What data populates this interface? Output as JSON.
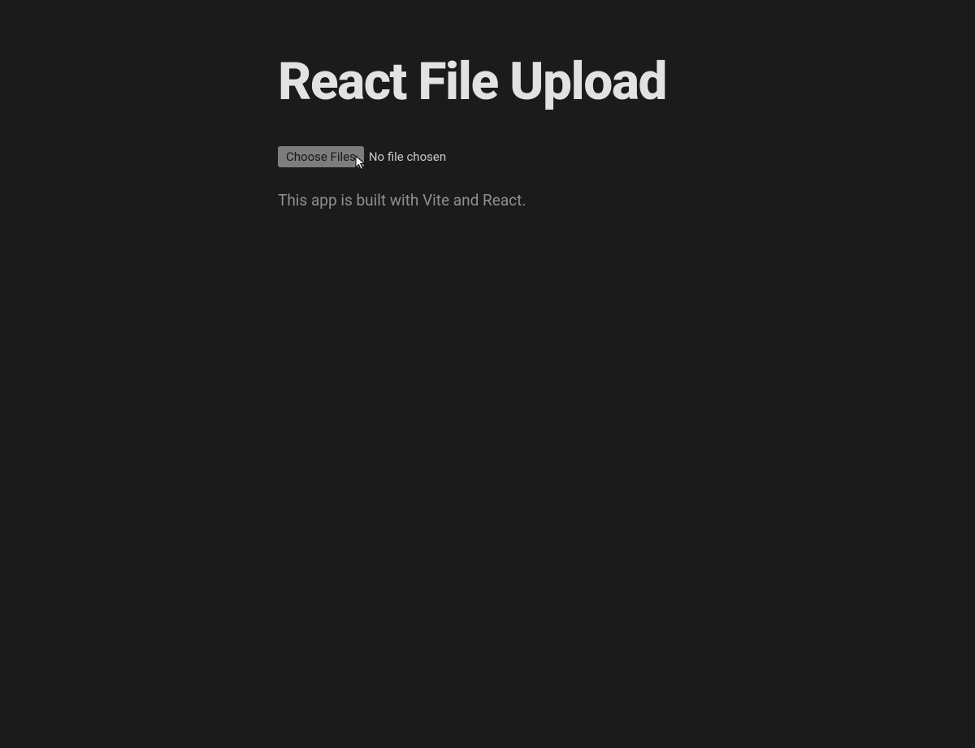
{
  "page": {
    "title": "React File Upload"
  },
  "fileInput": {
    "buttonLabel": "Choose Files",
    "statusText": "No file chosen"
  },
  "description": "This app is built with Vite and React."
}
